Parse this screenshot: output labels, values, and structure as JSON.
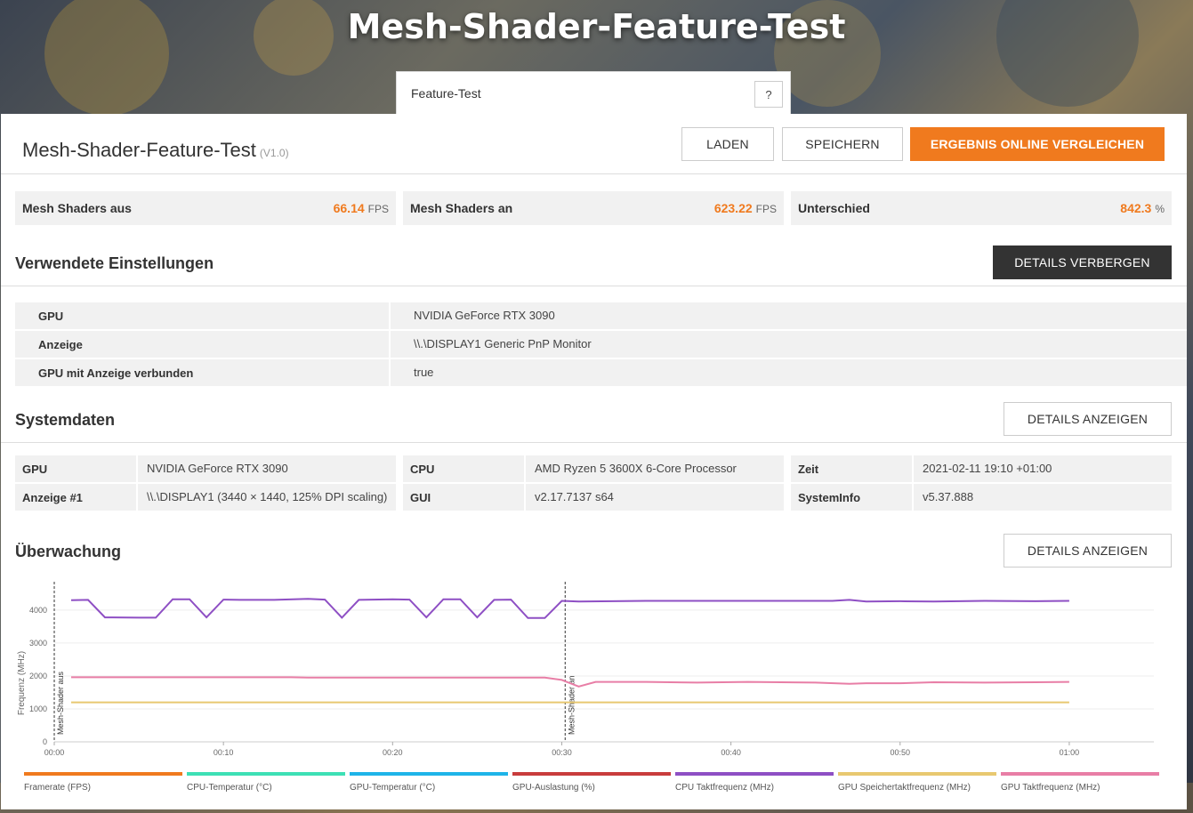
{
  "hero": {
    "title": "Mesh-Shader-Feature-Test"
  },
  "tab": {
    "label": "Feature-Test",
    "help": "?"
  },
  "header": {
    "title": "Mesh-Shader-Feature-Test",
    "version": "(V1.0)",
    "load_label": "LADEN",
    "save_label": "SPEICHERN",
    "compare_label": "ERGEBNIS ONLINE VERGLEICHEN"
  },
  "scores": [
    {
      "label": "Mesh Shaders aus",
      "value": "66.14",
      "unit": "FPS"
    },
    {
      "label": "Mesh Shaders an",
      "value": "623.22",
      "unit": "FPS"
    },
    {
      "label": "Unterschied",
      "value": "842.3",
      "unit": "%"
    }
  ],
  "settings": {
    "title": "Verwendete Einstellungen",
    "toggle_label": "DETAILS VERBERGEN",
    "rows": [
      {
        "key": "GPU",
        "value": "NVIDIA GeForce RTX 3090"
      },
      {
        "key": "Anzeige",
        "value": "\\\\.\\DISPLAY1 Generic PnP Monitor"
      },
      {
        "key": "GPU mit Anzeige verbunden",
        "value": "true"
      }
    ]
  },
  "system": {
    "title": "Systemdaten",
    "toggle_label": "DETAILS ANZEIGEN",
    "rows": [
      [
        {
          "key": "GPU",
          "value": "NVIDIA GeForce RTX 3090"
        },
        {
          "key": "CPU",
          "value": "AMD Ryzen 5 3600X 6-Core Processor"
        },
        {
          "key": "Zeit",
          "value": "2021-02-11 19:10 +01:00"
        }
      ],
      [
        {
          "key": "Anzeige #1",
          "value": "\\\\.\\DISPLAY1 (3440 × 1440, 125% DPI scaling)"
        },
        {
          "key": "GUI",
          "value": "v2.17.7137 s64"
        },
        {
          "key": "SystemInfo",
          "value": "v5.37.888"
        }
      ]
    ]
  },
  "monitoring": {
    "title": "Überwachung",
    "toggle_label": "DETAILS ANZEIGEN"
  },
  "chart_data": {
    "type": "line",
    "ylabel": "Frequenz (MHz)",
    "xlabel": "",
    "ylim": [
      0,
      4700
    ],
    "xlim": [
      0,
      65
    ],
    "y_ticks": [
      0,
      1000,
      2000,
      3000,
      4000
    ],
    "y_tick_labels": [
      "0",
      "1000",
      "2000",
      "3000",
      "4000"
    ],
    "x_ticks": [
      0,
      10,
      20,
      30,
      40,
      50,
      60
    ],
    "x_tick_labels": [
      "00:00",
      "00:10",
      "00:20",
      "00:30",
      "00:40",
      "00:50",
      "01:00"
    ],
    "markers": [
      {
        "x": 0,
        "label": "Mesh-Shader aus"
      },
      {
        "x": 30.2,
        "label": "Mesh-Shader an"
      }
    ],
    "legend": [
      {
        "name": "Framerate (FPS)",
        "color": "#f07a1e"
      },
      {
        "name": "CPU-Temperatur (°C)",
        "color": "#3de0b5"
      },
      {
        "name": "GPU-Temperatur (°C)",
        "color": "#1eb4e8"
      },
      {
        "name": "GPU-Auslastung (%)",
        "color": "#c83c3c"
      },
      {
        "name": "CPU Taktfrequenz (MHz)",
        "color": "#8e4fc4"
      },
      {
        "name": "GPU Speichertaktfrequenz (MHz)",
        "color": "#e8c870"
      },
      {
        "name": "GPU Taktfrequenz (MHz)",
        "color": "#e87ea6"
      }
    ],
    "series": [
      {
        "name": "CPU Taktfrequenz (MHz)",
        "color": "#8e4fc4",
        "x": [
          1,
          2,
          3,
          5,
          6,
          7,
          8,
          9,
          10,
          11,
          13,
          15,
          16,
          17,
          18,
          20,
          21,
          22,
          23,
          24,
          25,
          26,
          27,
          28,
          29,
          30,
          31,
          35,
          40,
          46,
          47,
          48,
          50,
          52,
          55,
          58,
          60
        ],
        "y": [
          4300,
          4310,
          3780,
          3770,
          3770,
          4330,
          4330,
          3780,
          4320,
          4310,
          4310,
          4340,
          4320,
          3770,
          4310,
          4330,
          4320,
          3780,
          4330,
          4330,
          3780,
          4310,
          4320,
          3760,
          3760,
          4280,
          4260,
          4280,
          4280,
          4280,
          4310,
          4260,
          4270,
          4260,
          4280,
          4270,
          4280
        ]
      },
      {
        "name": "GPU Taktfrequenz (MHz)",
        "color": "#e87ea6",
        "x": [
          1,
          5,
          10,
          14,
          15,
          20,
          25,
          29,
          30,
          31,
          32,
          35,
          38,
          41,
          45,
          47,
          48,
          50,
          52,
          55,
          58,
          60
        ],
        "y": [
          1960,
          1960,
          1960,
          1960,
          1950,
          1950,
          1950,
          1950,
          1880,
          1680,
          1820,
          1820,
          1800,
          1820,
          1800,
          1760,
          1780,
          1780,
          1810,
          1800,
          1810,
          1820
        ]
      },
      {
        "name": "GPU Speichertaktfrequenz (MHz)",
        "color": "#e8c870",
        "x": [
          1,
          60
        ],
        "y": [
          1200,
          1200
        ]
      }
    ]
  }
}
